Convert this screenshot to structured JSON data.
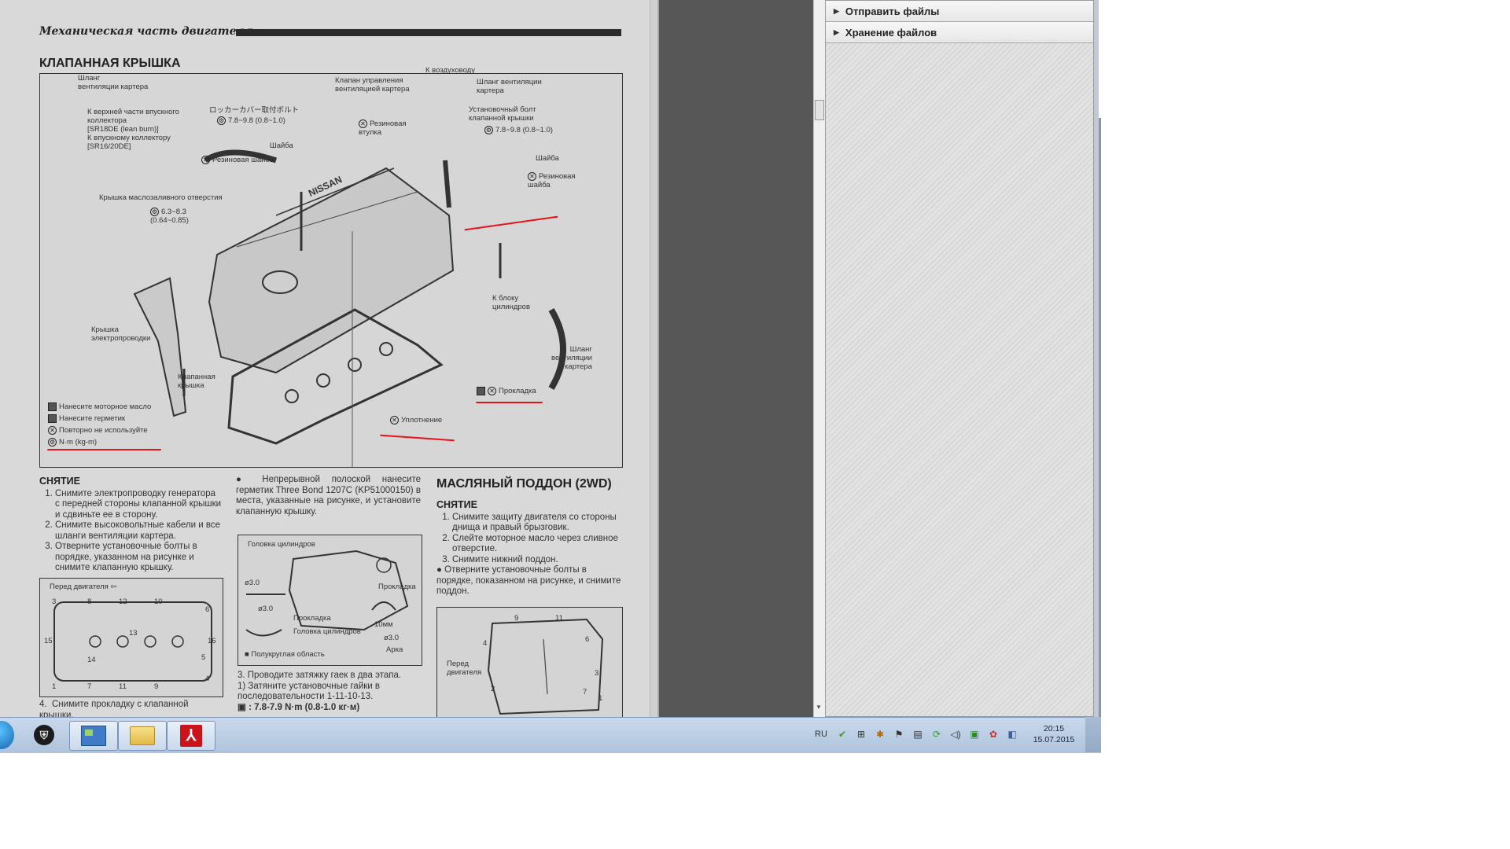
{
  "document": {
    "section_header": "Механическая часть двигателя",
    "title": "КЛАПАННАЯ КРЫШКА",
    "labels": {
      "hose_top": "Шланг\nвентиляции картера",
      "to_intake_top": "К верхней части впускного\nколлектора\n[SR18DE (lean burn)]\nК впускному коллектору\n[SR16/20DE]",
      "valve_ctrl": "Клапан управления\nвентиляцией картера",
      "to_air_duct": "К воздуховоду",
      "hose_right": "Шланг вентиляции\nкартера",
      "jp_bolt": "ロッカーカバー取付ボルト",
      "torque_left": "7.8~9.8 (0.8~1.0)",
      "rubber_bushing": "Резиновая\nвтулка",
      "mount_bolt": "Установочный болт\nклапанной крышки",
      "torque_right": "7.8~9.8 (0.8~1.0)",
      "washer_left": "Шайба",
      "rubber_washer_left": "Резиновая шайба",
      "washer_right": "Шайба",
      "rubber_washer_right": "Резиновая\nшайба",
      "oil_filler_cap": "Крышка маслозаливного отверстия",
      "torque_cap": "6.3~8.3\n(0.64~0.85)",
      "to_cylinder_block": "К блоку\nцилиндров",
      "hose_bottom": "Шланг\nвентиляции\nкартера",
      "harness_cover": "Крышка\nэлектропроводки",
      "valve_cover": "Клапанная\nкрышка",
      "gasket": "Прокладка",
      "seal": "Уплотнение",
      "nissan": "NISSAN"
    },
    "legend": [
      "Нанесите моторное масло",
      "Нанесите герметик",
      "Повторно не используйте",
      "N·m (kg-m)"
    ],
    "removal": {
      "heading": "СНЯТИЕ",
      "steps": [
        "Снимите электропроводку генератора с передней стороны клапанной крышки и сдвиньте ее в сторону.",
        "Снимите высоковольтные кабели и все шланги вентиляции картера.",
        "Отверните установочные болты в порядке, указанном на рисунке и снимите клапанную крышку."
      ],
      "step4": "Снимите прокладку с клапанной крышки."
    },
    "front_of_engine": "Перед двигателя",
    "bolt_numbers_top": [
      "3",
      "8",
      "12",
      "10",
      "6"
    ],
    "bolt_numbers_bottom": [
      "1",
      "7",
      "11",
      "9",
      "4"
    ],
    "bolt_numbers_side": [
      "15",
      "13",
      "14",
      "16",
      "5"
    ],
    "sealant": {
      "bullet": "Непрерывной полоской нанесите герметик Three Bond 1207C (KP51000150) в места, указанные на рисунке, и установите клапанную крышку.",
      "box_labels": {
        "cyl_head_top": "Головка цилиндров",
        "gasket_right": "Прокладка",
        "gasket_bottom": "Прокладка",
        "cyl_head_bottom": "Головка цилиндров",
        "dim_a": "ø3.0",
        "dim_b": "ø3.0",
        "dim_c": "ø3.0",
        "dim_10": "10мм",
        "arc": "Арка",
        "semicircle": "Полукруглая область"
      },
      "steps": [
        "3. Проводите затяжку гаек в два этапа.",
        "1)  Затяните установочные гайки в последовательности 1-11-10-13."
      ],
      "torque_line": ": 7.8-7.9 N·m (0.8-1.0 кг·м)"
    },
    "oil_pan": {
      "title": "МАСЛЯНЫЙ ПОДДОН (2WD)",
      "heading": "СНЯТИЕ",
      "steps": [
        "Снимите защиту двигателя со стороны днища и правый брызговик.",
        "Слейте моторное масло через сливное отверстие.",
        "Снимите нижний поддон."
      ],
      "bullet": "Отверните установочные болты в порядке, показанном на рисунке, и снимите поддон.",
      "front_of_engine": "Перед\nдвигателя",
      "numbers": [
        "9",
        "11",
        "4",
        "6",
        "3",
        "2",
        "7",
        "1"
      ]
    }
  },
  "file_panel": {
    "items": [
      {
        "label": "Отправить файлы"
      },
      {
        "label": "Хранение файлов"
      }
    ]
  },
  "taskbar": {
    "apps": [
      "world-of-tanks",
      "control-panel",
      "file-explorer",
      "adobe-reader"
    ],
    "tray": {
      "language": "RU",
      "time": "20:15",
      "date": "15.07.2015"
    }
  },
  "colors": {
    "annotation_red": "#e8121a",
    "taskbar": "#b9cde4",
    "dark_gap": "#575757"
  }
}
